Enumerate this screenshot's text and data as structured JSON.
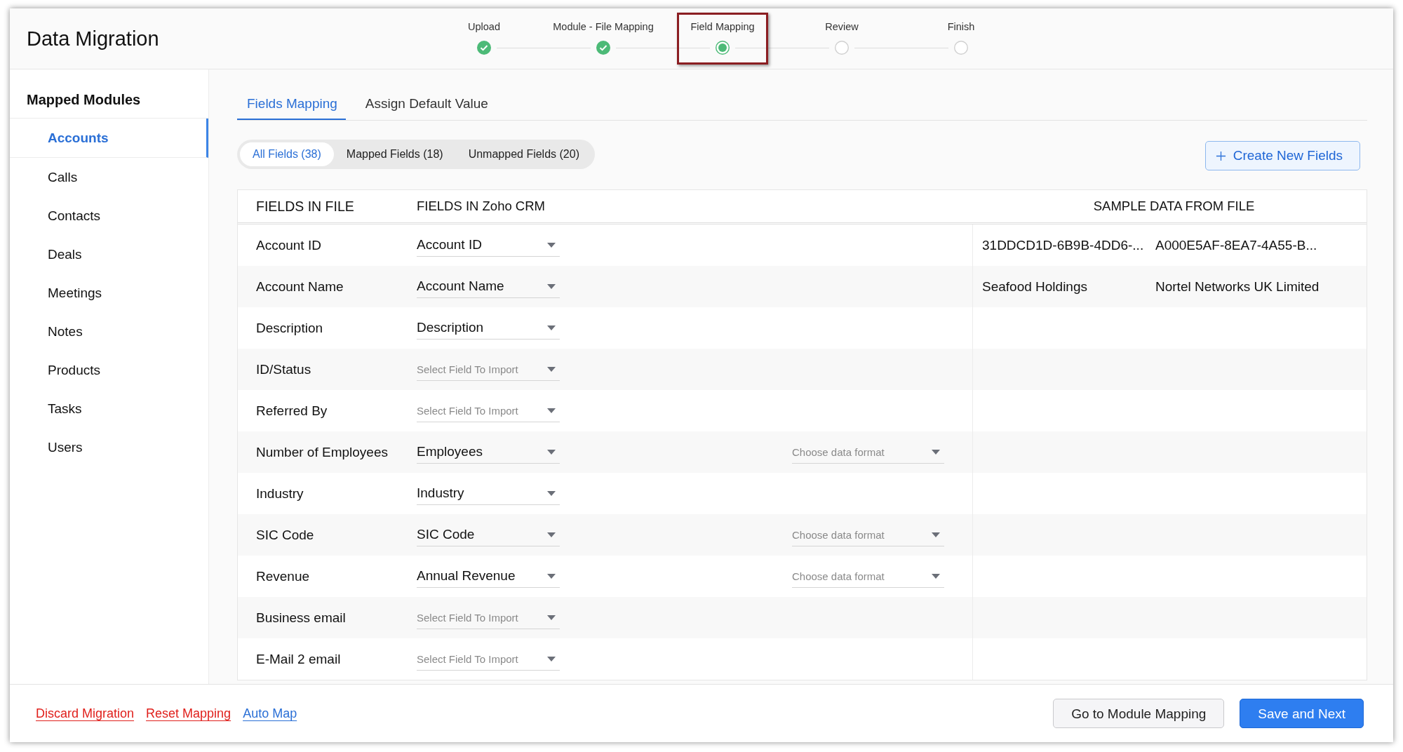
{
  "window": {
    "title": "Data Migration"
  },
  "steps": [
    {
      "label": "Upload",
      "completed": true,
      "selected": false,
      "highlighted": false
    },
    {
      "label": "Module - File Mapping",
      "completed": true,
      "selected": false,
      "highlighted": false
    },
    {
      "label": "Field Mapping",
      "completed": false,
      "selected": true,
      "highlighted": true
    },
    {
      "label": "Review",
      "completed": false,
      "selected": false,
      "highlighted": false
    },
    {
      "label": "Finish",
      "completed": false,
      "selected": false,
      "highlighted": false
    }
  ],
  "sidebar": {
    "title": "Mapped Modules",
    "items": [
      {
        "label": "Accounts",
        "selected": true
      },
      {
        "label": "Calls",
        "selected": false
      },
      {
        "label": "Contacts",
        "selected": false
      },
      {
        "label": "Deals",
        "selected": false
      },
      {
        "label": "Meetings",
        "selected": false
      },
      {
        "label": "Notes",
        "selected": false
      },
      {
        "label": "Products",
        "selected": false
      },
      {
        "label": "Tasks",
        "selected": false
      },
      {
        "label": "Users",
        "selected": false
      }
    ]
  },
  "tabs": [
    {
      "label": "Fields Mapping",
      "selected": true
    },
    {
      "label": "Assign Default Value",
      "selected": false
    }
  ],
  "filters": [
    {
      "label": "All Fields (38)",
      "selected": true
    },
    {
      "label": "Mapped Fields (18)",
      "selected": false
    },
    {
      "label": "Unmapped Fields (20)",
      "selected": false
    }
  ],
  "create_button": {
    "label": "Create New Fields"
  },
  "table": {
    "columns": [
      "FIELDS IN FILE",
      "FIELDS IN Zoho CRM",
      "SAMPLE DATA FROM FILE"
    ],
    "rows": [
      {
        "file_field": "Account ID",
        "crm_field": {
          "value": "Account ID"
        },
        "samples": [
          "31DDCD1D-6B9B-4DD6-...",
          "A000E5AF-8EA7-4A55-B..."
        ]
      },
      {
        "file_field": "Account Name",
        "crm_field": {
          "value": "Account Name"
        },
        "samples": [
          "Seafood Holdings",
          "Nortel Networks UK Limited"
        ]
      },
      {
        "file_field": "Description",
        "crm_field": {
          "value": "Description"
        }
      },
      {
        "file_field": "ID/Status",
        "crm_field": {
          "placeholder": "Select Field To Import"
        }
      },
      {
        "file_field": "Referred By",
        "crm_field": {
          "placeholder": "Select Field To Import"
        }
      },
      {
        "file_field": "Number of Employees",
        "crm_field": {
          "value": "Employees"
        },
        "data_format": {
          "placeholder": "Choose data format"
        }
      },
      {
        "file_field": "Industry",
        "crm_field": {
          "value": "Industry"
        }
      },
      {
        "file_field": "SIC Code",
        "crm_field": {
          "value": "SIC Code"
        },
        "data_format": {
          "placeholder": "Choose data format"
        }
      },
      {
        "file_field": "Revenue",
        "crm_field": {
          "value": "Annual Revenue"
        },
        "data_format": {
          "placeholder": "Choose data format"
        }
      },
      {
        "file_field": "Business email",
        "crm_field": {
          "placeholder": "Select Field To Import"
        }
      },
      {
        "file_field": "E-Mail 2 email",
        "crm_field": {
          "placeholder": "Select Field To Import"
        }
      }
    ]
  },
  "footer": {
    "links": [
      {
        "label": "Discard Migration",
        "kind": "danger"
      },
      {
        "label": "Reset Mapping",
        "kind": "danger"
      },
      {
        "label": "Auto Map",
        "kind": "primary"
      }
    ],
    "buttons": [
      {
        "label": "Go to Module Mapping",
        "kind": "secondary"
      },
      {
        "label": "Save and Next",
        "kind": "primary"
      }
    ]
  }
}
